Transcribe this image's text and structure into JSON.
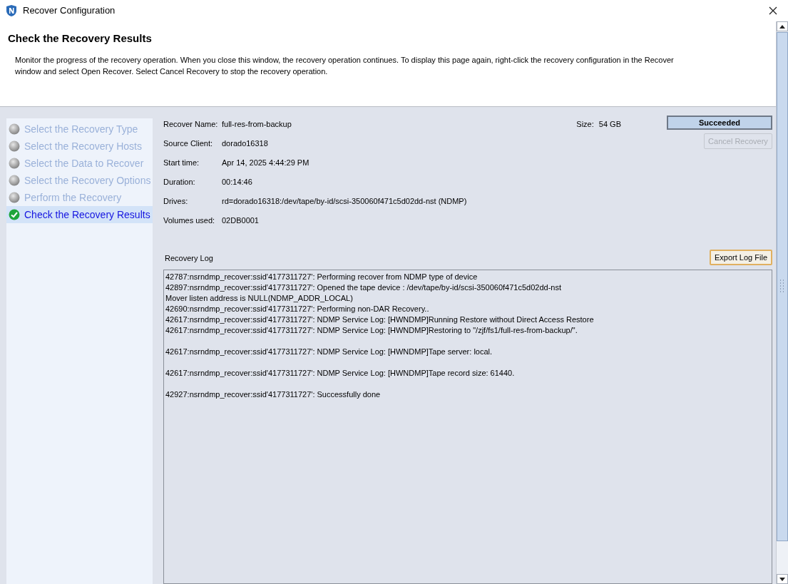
{
  "window": {
    "title": "Recover Configuration"
  },
  "header": {
    "title": "Check the Recovery Results",
    "description": "Monitor the progress of the recovery operation. When you close this window, the recovery operation continues. To display this page again, right-click the recovery configuration in the Recover window and select Open Recover. Select Cancel Recovery to stop the recovery operation."
  },
  "steps": [
    {
      "label": "Select the Recovery Type",
      "completed": false,
      "selected": false
    },
    {
      "label": "Select the Recovery Hosts",
      "completed": false,
      "selected": false
    },
    {
      "label": "Select the Data to Recover",
      "completed": false,
      "selected": false
    },
    {
      "label": "Select the Recovery Options",
      "completed": false,
      "selected": false
    },
    {
      "label": "Perform the Recovery",
      "completed": false,
      "selected": false
    },
    {
      "label": "Check the Recovery Results",
      "completed": true,
      "selected": true
    }
  ],
  "details": [
    {
      "label": "Recover Name:",
      "value": "full-res-from-backup"
    },
    {
      "label": "Source Client:",
      "value": "dorado16318"
    },
    {
      "label": "Start time:",
      "value": "Apr 14, 2025 4:44:29 PM"
    },
    {
      "label": "Duration:",
      "value": "00:14:46"
    },
    {
      "label": "Drives:",
      "value": "rd=dorado16318:/dev/tape/by-id/scsi-350060f471c5d02dd-nst (NDMP)"
    },
    {
      "label": "Volumes used:",
      "value": "02DB0001"
    }
  ],
  "size": {
    "label": "Size:",
    "value": "54 GB"
  },
  "status": "Succeeded",
  "cancel_button": {
    "label": "Cancel Recovery",
    "disabled": true
  },
  "log": {
    "title": "Recovery Log",
    "export_button": "Export Log File",
    "blocks": [
      [
        "42787:nsrndmp_recover:ssid'4177311727': Performing recover from NDMP type of device",
        "42897:nsrndmp_recover:ssid'4177311727': Opened the tape device : /dev/tape/by-id/scsi-350060f471c5d02dd-nst",
        "Mover listen address is NULL(NDMP_ADDR_LOCAL)",
        "42690:nsrndmp_recover:ssid'4177311727': Performing non-DAR Recovery..",
        "42617:nsrndmp_recover:ssid'4177311727': NDMP Service Log: [HWNDMP]Running Restore without Direct Access Restore",
        "42617:nsrndmp_recover:ssid'4177311727': NDMP Service Log: [HWNDMP]Restoring to \"/zjf/fs1/full-res-from-backup/\"."
      ],
      [
        "42617:nsrndmp_recover:ssid'4177311727': NDMP Service Log: [HWNDMP]Tape server: local."
      ],
      [
        "42617:nsrndmp_recover:ssid'4177311727': NDMP Service Log: [HWNDMP]Tape record size: 61440."
      ],
      [
        "42927:nsrndmp_recover:ssid'4177311727': Successfully done"
      ]
    ]
  }
}
